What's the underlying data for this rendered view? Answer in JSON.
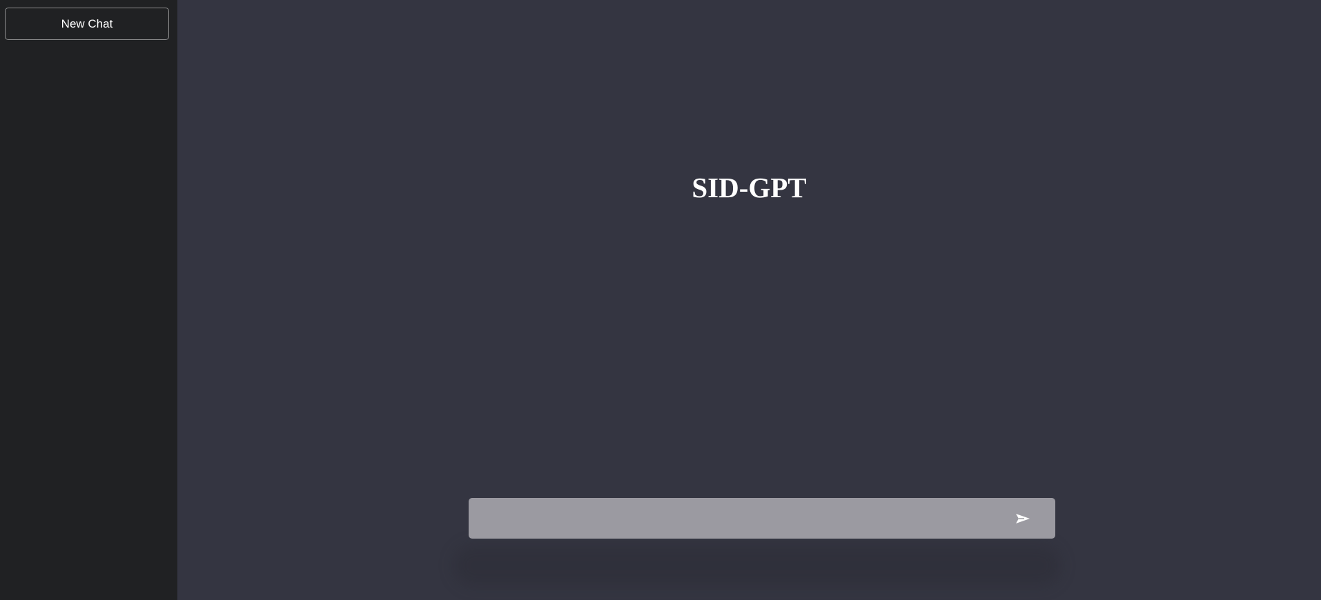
{
  "sidebar": {
    "new_chat_label": "New Chat"
  },
  "main": {
    "title": "SID-GPT"
  },
  "chat_input": {
    "value": "",
    "placeholder": "",
    "send_icon": "send-icon"
  },
  "colors": {
    "sidebar_bg": "#202123",
    "main_bg": "#343541",
    "input_bg": "#9b9aa1",
    "text": "#ffffff"
  }
}
